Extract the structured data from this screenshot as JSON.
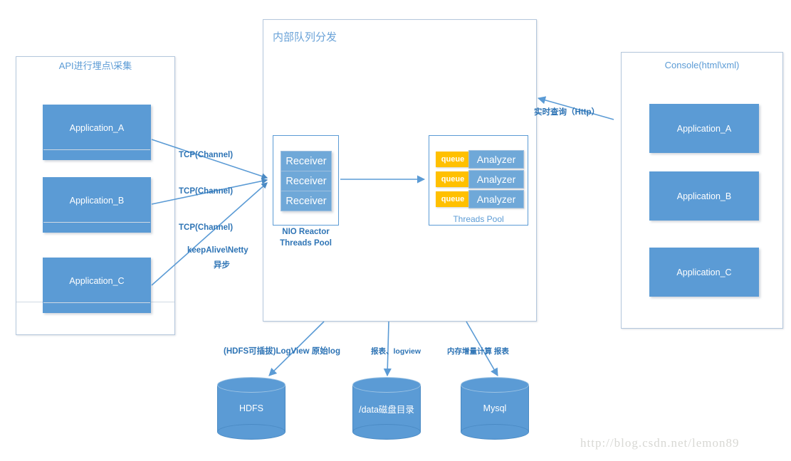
{
  "colors": {
    "box_blue": "#5b9bd5",
    "chip_blue": "#6fa8d8",
    "queue_yellow": "#ffc000",
    "label_blue": "#2e74b5",
    "panel_border": "#b4c7dc",
    "watermark_grey": "#d8d8d4"
  },
  "left_panel": {
    "title": "API进行埋点\\采集",
    "apps": [
      {
        "label": "Application_A"
      },
      {
        "label": "Application_B"
      },
      {
        "label": "Application_C"
      }
    ]
  },
  "center_panel": {
    "title": "内部队列分发",
    "reactor": {
      "caption_line1": "NIO Reactor",
      "caption_line2": "Threads Pool",
      "receivers": [
        {
          "label": "Receiver"
        },
        {
          "label": "Receiver"
        },
        {
          "label": "Receiver"
        }
      ]
    },
    "threads_pool": {
      "caption": "Threads Pool",
      "rows": [
        {
          "queue": "queue",
          "analyzer": "Analyzer"
        },
        {
          "queue": "queue",
          "analyzer": "Analyzer"
        },
        {
          "queue": "queue",
          "analyzer": "Analyzer"
        }
      ]
    }
  },
  "right_panel": {
    "title": "Console(html\\xml)",
    "apps": [
      {
        "label": "Application_A"
      },
      {
        "label": "Application_B"
      },
      {
        "label": "Application_C"
      }
    ]
  },
  "edge_labels": {
    "tcp_1": "TCP(Channel)",
    "tcp_2": "TCP(Channel)",
    "tcp_3": "TCP(Channel)",
    "keepalive_line1": "keepAlive\\Netty",
    "keepalive_line2": "异步",
    "realtime_query": "实时查询（Http）",
    "hdfs_flow": "(HDFS可插拔)LogView 原始log",
    "data_flow": "报表、logview",
    "mysql_flow": "内存增量计算 报表"
  },
  "stores": [
    {
      "label": "HDFS"
    },
    {
      "label": "/data磁盘目录"
    },
    {
      "label": "Mysql"
    }
  ],
  "watermark": {
    "text": "http://blog.csdn.net/lemon89"
  }
}
